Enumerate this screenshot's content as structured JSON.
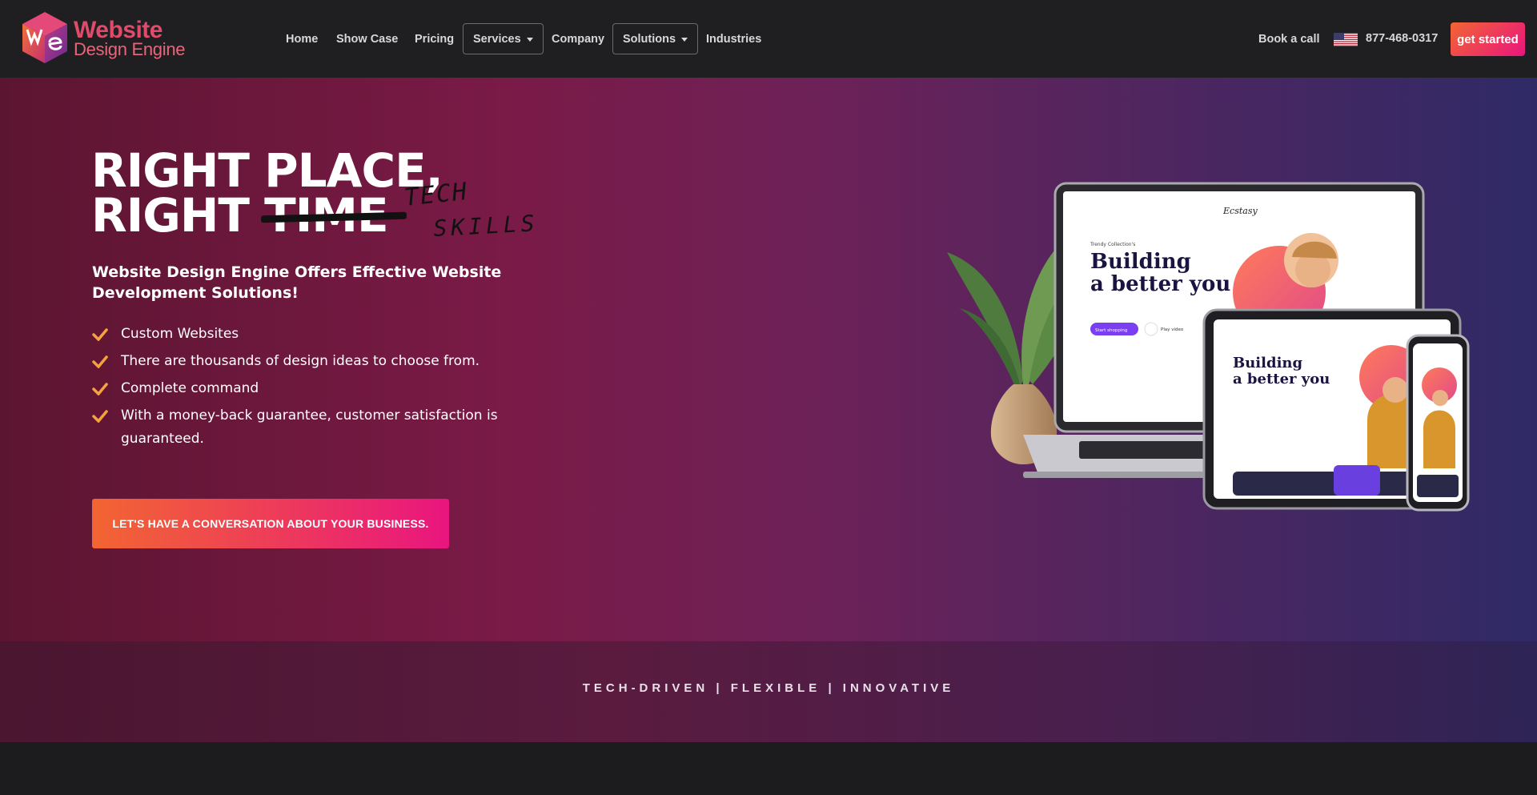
{
  "header": {
    "logo": {
      "line1": "Website",
      "line2": "Design Engine"
    },
    "nav": [
      {
        "label": "Home"
      },
      {
        "label": "Show Case"
      },
      {
        "label": "Pricing"
      },
      {
        "label": "Services"
      },
      {
        "label": "Company"
      },
      {
        "label": "Solutions"
      },
      {
        "label": "Industries"
      }
    ],
    "book_call": "Book a call",
    "phone": "877-468-0317",
    "cta": "get started"
  },
  "hero": {
    "title_line1": "RIGHT PLACE,",
    "title_line2_a": "RIGHT ",
    "title_line2_struck": "TIME",
    "handwritten_1": "TECH",
    "handwritten_2": "SKILLS",
    "subtitle": "Website Design Engine Offers Effective Website Development Solutions!",
    "features": [
      "Custom Websites",
      "There are thousands of design ideas to choose from.",
      "Complete command",
      "With a money-back guarantee, customer satisfaction is guaranteed."
    ],
    "cta": "LET'S HAVE A CONVERSATION ABOUT YOUR BUSINESS.",
    "mockup": {
      "brand": "Ecstasy",
      "collection": "Trendy Collection's",
      "headline_1": "Building",
      "headline_2": "a better you",
      "button": "Start shopping",
      "play": "Play video"
    }
  },
  "band": {
    "tagline": "TECH-DRIVEN | FLEXIBLE | INNOVATIVE"
  },
  "colors": {
    "accent_orange": "#f26532",
    "accent_pink": "#e9157f",
    "check": "#f5a33b",
    "nav_bg": "#1f1f21"
  }
}
